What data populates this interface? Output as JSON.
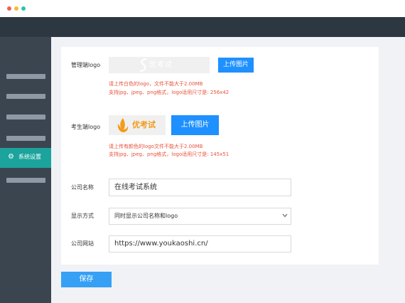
{
  "sidebar": {
    "active_item_label": "系统设置"
  },
  "form": {
    "admin_logo": {
      "label": "管理端logo",
      "logo_text": "优考试",
      "upload_label": "上传图片",
      "hint_line1": "请上传白色的logo，文件不能大于2.00MB",
      "hint_line2": "支持jpg、jpeg、png格式，logo适用尺寸是: 256x42"
    },
    "exam_logo": {
      "label": "考生端logo",
      "logo_text": "优考试",
      "upload_label": "上传图片",
      "hint_line1": "请上传有颜色的logo文件不能大于2.00MB",
      "hint_line2": "支持jpg、jpeg、png格式，logo适用尺寸是: 145x51"
    },
    "company_name": {
      "label": "公司名称",
      "value": "在线考试系统"
    },
    "display_mode": {
      "label": "显示方式",
      "selected": "同时显示公司名称和logo"
    },
    "company_url": {
      "label": "公司网站",
      "value": "https://www.youkaoshi.cn/"
    },
    "save_label": "保存"
  },
  "colors": {
    "topbar": "#2d3741",
    "sidebar": "#3b4550",
    "active": "#1ba39c",
    "primary": "#1e90ff",
    "hint": "#e8523a",
    "logo_orange": "#f39b1a"
  }
}
